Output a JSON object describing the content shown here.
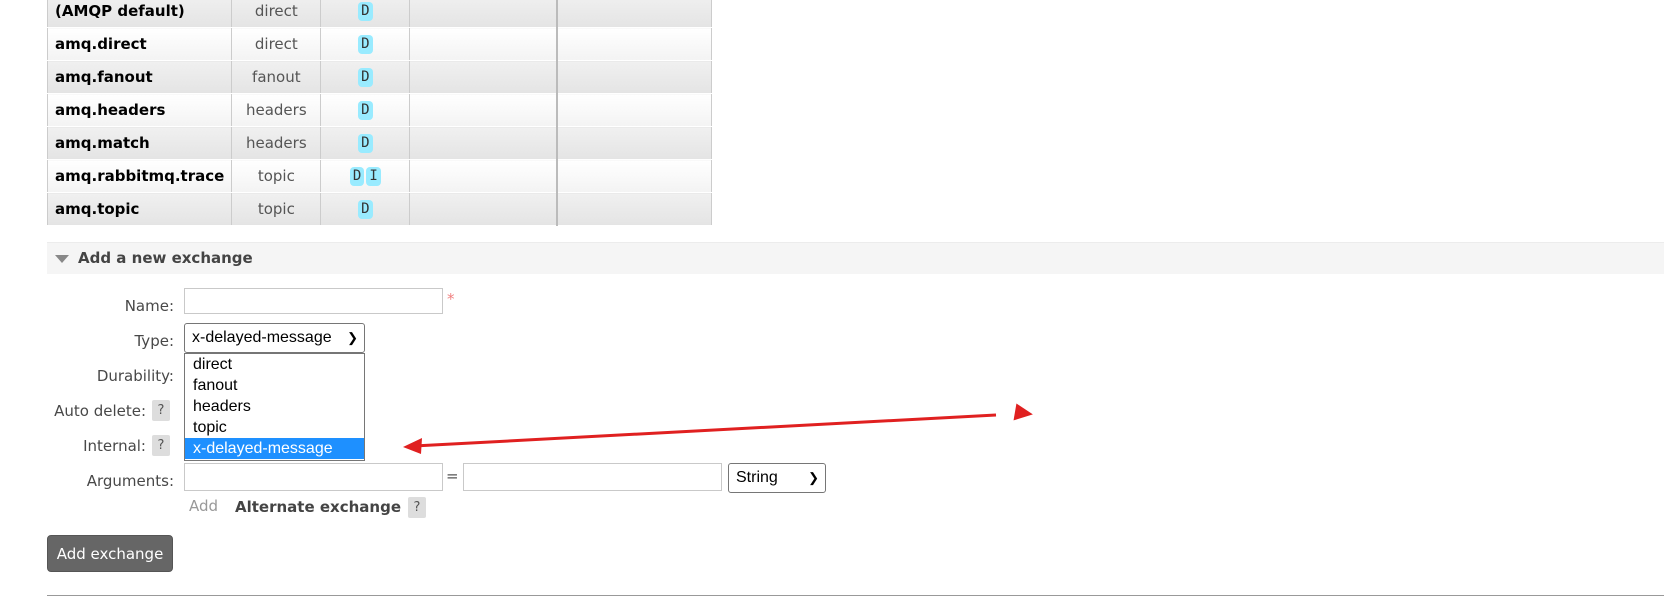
{
  "exchanges": [
    {
      "name": "(AMQP default)",
      "type": "direct",
      "features": [
        "D"
      ]
    },
    {
      "name": "amq.direct",
      "type": "direct",
      "features": [
        "D"
      ]
    },
    {
      "name": "amq.fanout",
      "type": "fanout",
      "features": [
        "D"
      ]
    },
    {
      "name": "amq.headers",
      "type": "headers",
      "features": [
        "D"
      ]
    },
    {
      "name": "amq.match",
      "type": "headers",
      "features": [
        "D"
      ]
    },
    {
      "name": "amq.rabbitmq.trace",
      "type": "topic",
      "features": [
        "D",
        "I"
      ]
    },
    {
      "name": "amq.topic",
      "type": "topic",
      "features": [
        "D"
      ]
    }
  ],
  "section": {
    "title": "Add a new exchange"
  },
  "form": {
    "name_label": "Name:",
    "name_value": "",
    "required_mark": "*",
    "type_label": "Type:",
    "type_selected": "x-delayed-message",
    "type_options": [
      "direct",
      "fanout",
      "headers",
      "topic",
      "x-delayed-message"
    ],
    "durability_label": "Durability:",
    "auto_delete_label": "Auto delete:",
    "internal_label": "Internal:",
    "help_mark": "?",
    "arguments_label": "Arguments:",
    "arg_key": "",
    "arg_value": "",
    "equals": "=",
    "arg_type_selected": "String",
    "add_link": "Add",
    "alternate_exchange": "Alternate exchange",
    "submit_label": "Add exchange"
  },
  "colors": {
    "badge": "#99ebff",
    "selected_option": "#1e90ff",
    "annotation_arrow": "#e02020",
    "button": "#666666"
  }
}
